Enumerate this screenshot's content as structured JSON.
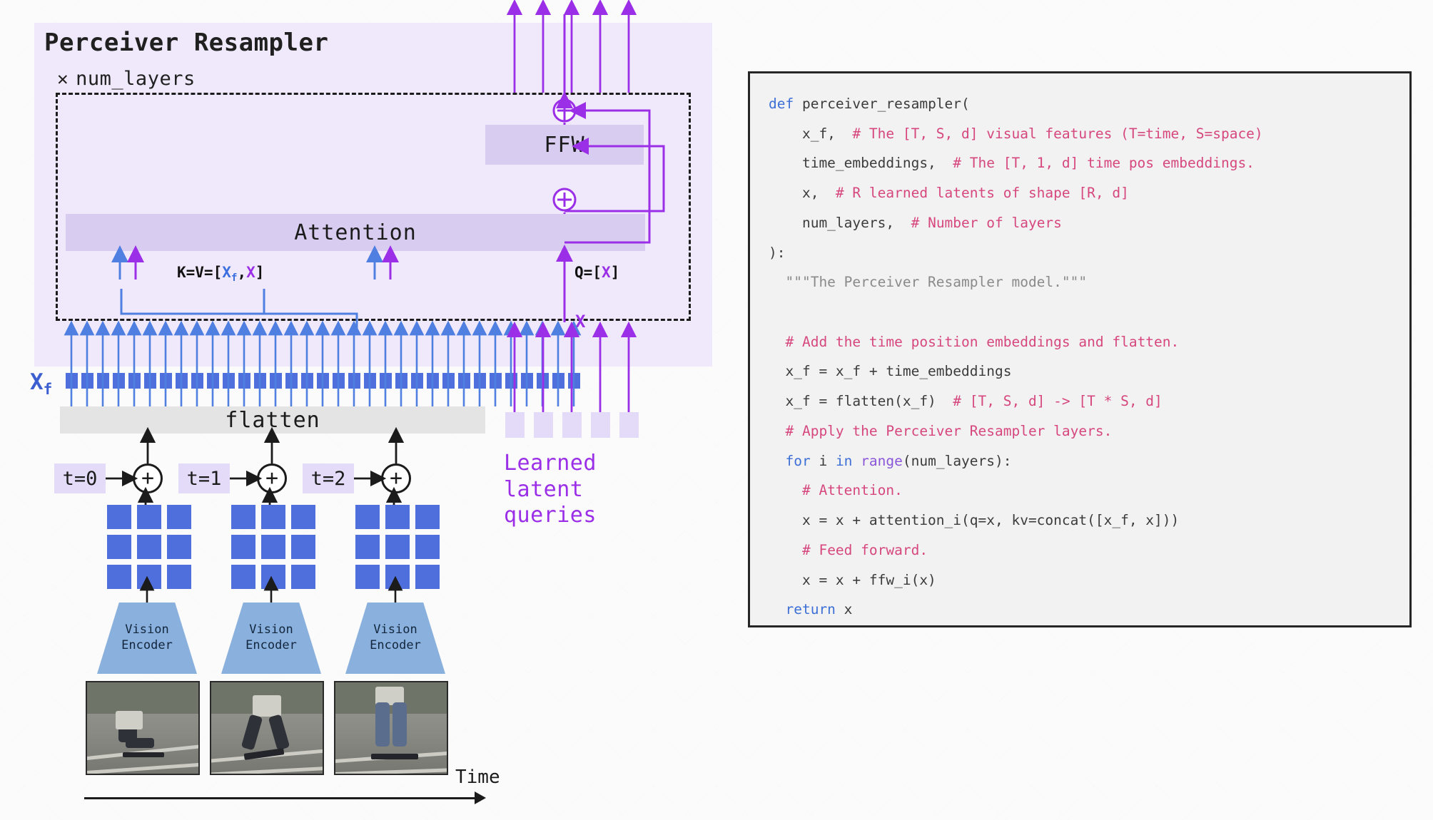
{
  "diagram": {
    "panel_title": "Perceiver Resampler",
    "num_layers_label": "num_layers",
    "times_symbol": "✕",
    "attention_label": "Attention",
    "ffw_label": "FFW",
    "kv_label_prefix": "K=V=[",
    "kv_xf": "X",
    "kv_xf_sub": "f",
    "kv_comma": ",",
    "kv_x": "X",
    "kv_close": "]",
    "q_label_prefix": "Q=[",
    "q_x": "X",
    "q_close": "]",
    "x_latent_label": "X",
    "xf_label": "X",
    "xf_sub": "f",
    "flatten_label": "flatten",
    "learned_latents_label": "Learned\nlatent\nqueries",
    "time_label": "Time",
    "time_chips": [
      "t=0",
      "t=1",
      "t=2"
    ],
    "plus_symbol": "+",
    "vision_encoder_label": "Vision\nEncoder",
    "vision_encoders": [
      "Vision Encoder",
      "Vision Encoder",
      "Vision Encoder"
    ],
    "num_tokens": 33,
    "num_latent_queries": 5,
    "grid_cells": 9,
    "colors": {
      "panel_bg": "#f0e9fb",
      "bar_bg": "#d8cdf0",
      "token_blue": "#4f6fdc",
      "arrow_blue": "#4f7fe0",
      "arrow_purple": "#9b2fe8",
      "encoder_blue": "#8ab0dd",
      "flatten_gray": "#e4e4e4",
      "latent_lilac": "#e3dbf8"
    }
  },
  "code": {
    "lines": [
      [
        {
          "t": "def ",
          "c": "k"
        },
        {
          "t": "perceiver_resampler(",
          "c": "op"
        }
      ],
      [
        {
          "t": "    x_f,  ",
          "c": "op"
        },
        {
          "t": "# The [T, S, d] visual features (T=time, S=space)",
          "c": "cm"
        }
      ],
      [
        {
          "t": "    time_embeddings,  ",
          "c": "op"
        },
        {
          "t": "# The [T, 1, d] time pos embeddings.",
          "c": "cm"
        }
      ],
      [
        {
          "t": "    x,  ",
          "c": "op"
        },
        {
          "t": "# R learned latents of shape [R, d]",
          "c": "cm"
        }
      ],
      [
        {
          "t": "    num_layers,  ",
          "c": "op"
        },
        {
          "t": "# Number of layers",
          "c": "cm"
        }
      ],
      [
        {
          "t": "):",
          "c": "op"
        }
      ],
      [
        {
          "t": "  \"\"\"The Perceiver Resampler model.\"\"\"",
          "c": "ds"
        }
      ],
      [
        {
          "t": "",
          "c": "op"
        }
      ],
      [
        {
          "t": "  ",
          "c": "op"
        },
        {
          "t": "# Add the time position embeddings and flatten.",
          "c": "cm"
        }
      ],
      [
        {
          "t": "  x_f = x_f + time_embeddings",
          "c": "op"
        }
      ],
      [
        {
          "t": "  x_f = flatten(x_f)  ",
          "c": "op"
        },
        {
          "t": "# [T, S, d] -> [T * S, d]",
          "c": "cm"
        }
      ],
      [
        {
          "t": "  ",
          "c": "op"
        },
        {
          "t": "# Apply the Perceiver Resampler layers.",
          "c": "cm"
        }
      ],
      [
        {
          "t": "  ",
          "c": "op"
        },
        {
          "t": "for ",
          "c": "k"
        },
        {
          "t": "i ",
          "c": "op"
        },
        {
          "t": "in ",
          "c": "k"
        },
        {
          "t": "range",
          "c": "fn"
        },
        {
          "t": "(num_layers):",
          "c": "op"
        }
      ],
      [
        {
          "t": "    ",
          "c": "op"
        },
        {
          "t": "# Attention.",
          "c": "cm"
        }
      ],
      [
        {
          "t": "    x = x + attention_i(q=x, kv=concat([x_f, x]))",
          "c": "op"
        }
      ],
      [
        {
          "t": "    ",
          "c": "op"
        },
        {
          "t": "# Feed forward.",
          "c": "cm"
        }
      ],
      [
        {
          "t": "    x = x + ffw_i(x)",
          "c": "op"
        }
      ],
      [
        {
          "t": "  ",
          "c": "op"
        },
        {
          "t": "return ",
          "c": "k"
        },
        {
          "t": "x",
          "c": "op"
        }
      ]
    ]
  }
}
